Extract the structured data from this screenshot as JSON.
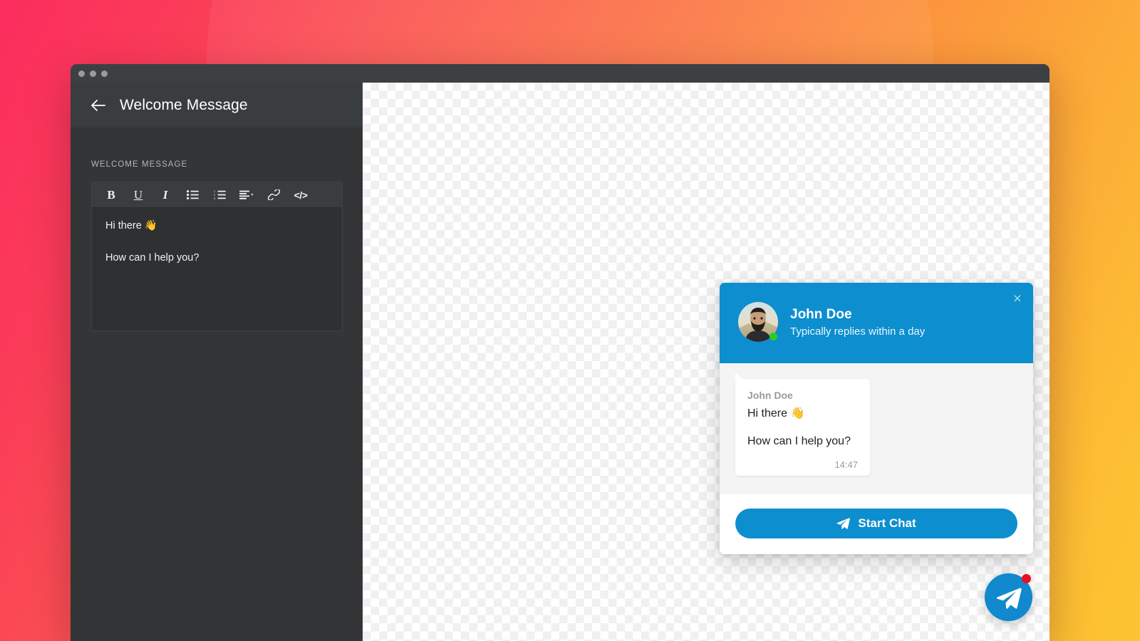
{
  "background": {
    "gradient_from": "#fb2d5e",
    "gradient_to": "#fdc431"
  },
  "window": {
    "traffic_lights": [
      "window-close-dot",
      "window-minimize-dot",
      "window-maximize-dot"
    ]
  },
  "panel": {
    "back_icon": "arrow-left-icon",
    "title": "Welcome Message",
    "field_label": "WELCOME MESSAGE",
    "toolbar": [
      {
        "name": "bold-button",
        "glyph": "B",
        "style": "tb-b"
      },
      {
        "name": "underline-button",
        "glyph": "U",
        "style": "tb-u"
      },
      {
        "name": "italic-button",
        "glyph": "I",
        "style": "tb-i"
      },
      {
        "name": "bullet-list-button",
        "glyph": "",
        "style": "tb-svg"
      },
      {
        "name": "numbered-list-button",
        "glyph": "",
        "style": "tb-svg"
      },
      {
        "name": "align-dropdown-button",
        "glyph": "",
        "style": "tb-svg"
      },
      {
        "name": "link-button",
        "glyph": "",
        "style": "tb-svg"
      },
      {
        "name": "code-button",
        "glyph": "</>",
        "style": "tb-code"
      }
    ],
    "editor_lines": [
      "Hi there 👋",
      "How can I help you?"
    ]
  },
  "widget": {
    "accent_color": "#0d8ecf",
    "close_label": "×",
    "agent_name": "John Doe",
    "agent_status": "Typically replies within a day",
    "online_indicator_color": "#2ecc1f",
    "message": {
      "sender": "John Doe",
      "lines": [
        "Hi there 👋",
        "How can I help you?"
      ],
      "time": "14:47"
    },
    "start_chat_label": "Start Chat"
  },
  "launcher": {
    "icon": "paper-plane-icon",
    "badge_color": "#e81123"
  }
}
